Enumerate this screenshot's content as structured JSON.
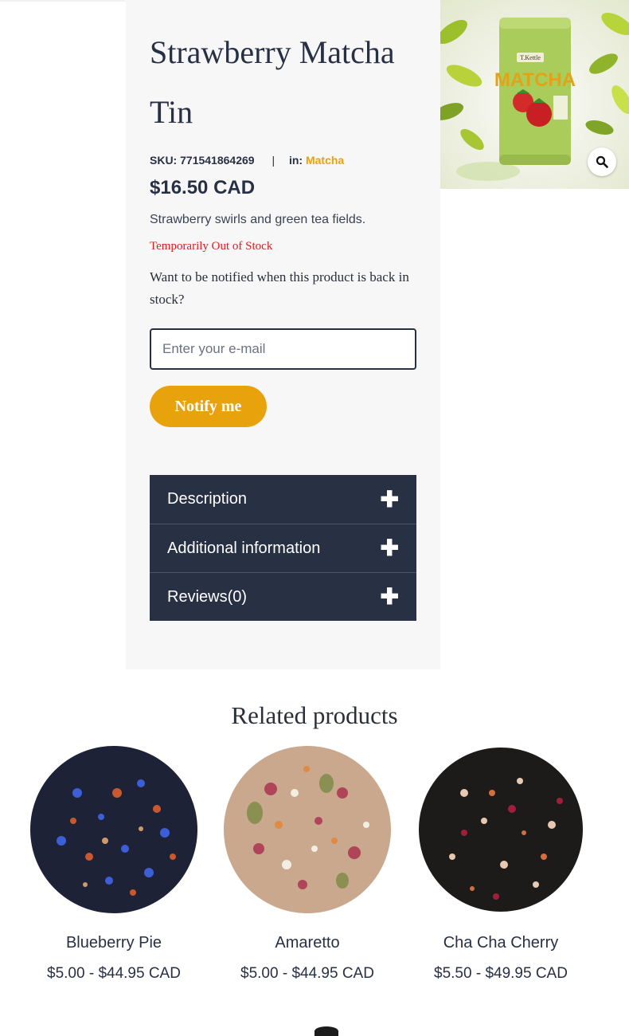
{
  "product": {
    "title": "Strawberry Matcha Tin",
    "sku_label": "SKU:",
    "sku": "771541864269",
    "separator": "|",
    "category_label": "in:",
    "category": "Matcha",
    "price": "$16.50 CAD",
    "short_description": "Strawberry swirls and green tea fields.",
    "stock_status": "Temporarily Out of Stock",
    "notify_question": "Want to be notified when this product is back in stock?",
    "email_placeholder": "Enter your e-mail",
    "notify_button": "Notify me",
    "image_tin_brand": "T.Kettle",
    "image_tin_text": "MATCHA"
  },
  "accordion": [
    {
      "label": "Description",
      "icon": "plus-icon"
    },
    {
      "label": "Additional information",
      "icon": "plus-icon"
    },
    {
      "label": "Reviews(0)",
      "icon": "plus-icon"
    }
  ],
  "related": {
    "title": "Related products",
    "items": [
      {
        "name": "Blueberry Pie",
        "price": "$5.00 - $44.95 CAD"
      },
      {
        "name": "Amaretto",
        "price": "$5.00 - $44.95 CAD"
      },
      {
        "name": "Cha Cha Cherry",
        "price": "$5.50 - $49.95 CAD"
      }
    ]
  },
  "colors": {
    "accent": "#e8a30c",
    "navy": "#283044",
    "out_of_stock": "#d22020",
    "panel_bg": "#f7f7f7"
  }
}
